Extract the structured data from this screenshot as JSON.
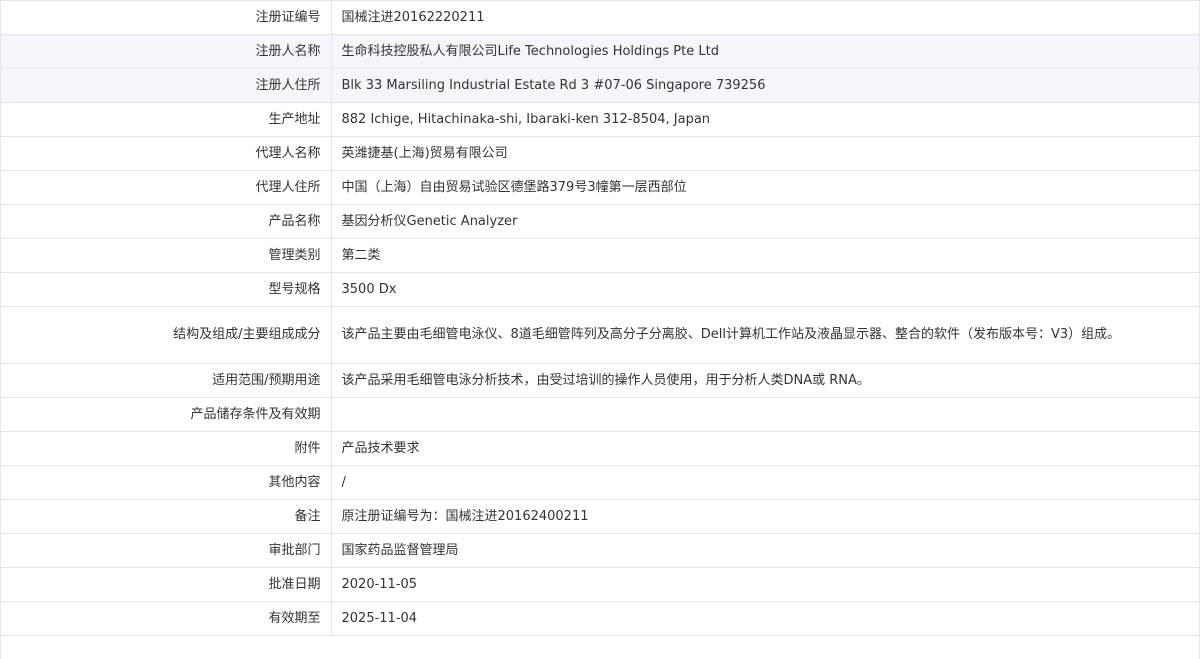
{
  "rows": [
    {
      "label": "注册证编号",
      "value": "国械注进20162220211"
    },
    {
      "label": "注册人名称",
      "value": "生命科技控股私人有限公司Life Technologies Holdings Pte Ltd"
    },
    {
      "label": "注册人住所",
      "value": "Blk 33 Marsiling Industrial Estate Rd 3 #07-06 Singapore 739256"
    },
    {
      "label": "生产地址",
      "value": "882 Ichige, Hitachinaka-shi, Ibaraki-ken 312-8504, Japan"
    },
    {
      "label": "代理人名称",
      "value": "英潍捷基(上海)贸易有限公司"
    },
    {
      "label": "代理人住所",
      "value": "中国（上海）自由贸易试验区德堡路379号3幢第一层西部位"
    },
    {
      "label": "产品名称",
      "value": "基因分析仪Genetic Analyzer"
    },
    {
      "label": "管理类别",
      "value": "第二类"
    },
    {
      "label": "型号规格",
      "value": "3500 Dx"
    },
    {
      "label": "结构及组成/主要组成成分",
      "value": "该产品主要由毛细管电泳仪、8道毛细管阵列及高分子分离胶、Dell计算机工作站及液晶显示器、整合的软件（发布版本号：V3）组成。"
    },
    {
      "label": "适用范围/预期用途",
      "value": "该产品采用毛细管电泳分析技术，由受过培训的操作人员使用，用于分析人类DNA或 RNA。"
    },
    {
      "label": "产品储存条件及有效期",
      "value": ""
    },
    {
      "label": "附件",
      "value": "产品技术要求"
    },
    {
      "label": "其他内容",
      "value": "/"
    },
    {
      "label": "备注",
      "value": "原注册证编号为：国械注进20162400211"
    },
    {
      "label": "审批部门",
      "value": "国家药品监督管理局"
    },
    {
      "label": "批准日期",
      "value": "2020-11-05"
    },
    {
      "label": "有效期至",
      "value": "2025-11-04"
    }
  ]
}
